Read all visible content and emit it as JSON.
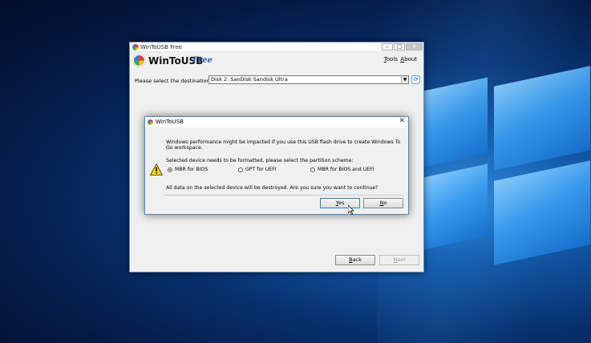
{
  "main_window": {
    "title": "WinToUSB Free",
    "brand_name": "WinToUSB",
    "brand_edition": "Free",
    "menu": {
      "tools": "Tools",
      "about": "About"
    },
    "destination_label": "Please select the destination disk:",
    "destination_value": "Disk 2: SanDisk Sandisk Ultra",
    "back_label": "Back",
    "next_label": "Next"
  },
  "dialog": {
    "title": "WinToUSB",
    "close_glyph": "✕",
    "message_performance": "Windows performance might be impacted if you use this USB flash drive to create Windows To Go workspace.",
    "message_format": "Selected device needs to be formatted, please select the partition scheme:",
    "options": [
      {
        "label": "MBR for BIOS",
        "checked": true
      },
      {
        "label": "GPT for UEFI",
        "checked": false
      },
      {
        "label": "MBR for BIOS and UEFI",
        "checked": false
      }
    ],
    "message_confirm": "All data on the selected device will be destroyed. Are you sure you want to continue?",
    "yes_label": "Yes",
    "no_label": "No"
  },
  "icons": {
    "warning": "warning-icon",
    "refresh": "refresh-icon",
    "app": "wintousb-logo-icon"
  },
  "colors": {
    "accent": "#2a5fb0",
    "warning": "#f5d21a"
  }
}
